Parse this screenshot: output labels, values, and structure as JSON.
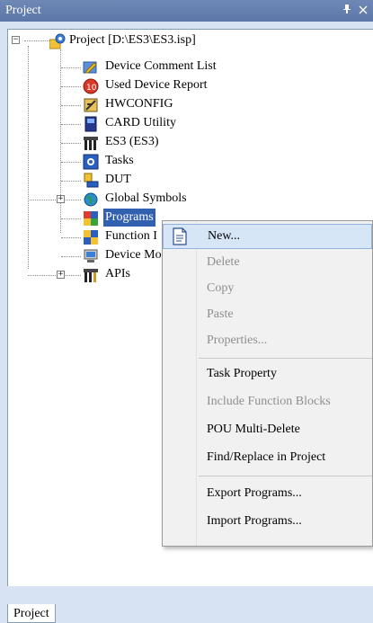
{
  "window": {
    "title": "Project",
    "pin_icon": "pin-icon",
    "close_icon": "close-icon"
  },
  "tree": {
    "root": {
      "label": "Project [D:\\ES3\\ES3.isp]",
      "icon": "project-gear-icon",
      "expander": "−"
    },
    "items": [
      {
        "label": "Device Comment List",
        "icon": "comment-list-icon"
      },
      {
        "label": "Used Device Report",
        "icon": "device-report-icon"
      },
      {
        "label": "HWCONFIG",
        "icon": "hwconfig-icon"
      },
      {
        "label": "CARD Utility",
        "icon": "card-utility-icon"
      },
      {
        "label": "ES3  (ES3)",
        "icon": "plc-device-icon"
      },
      {
        "label": "Tasks",
        "icon": "tasks-icon"
      },
      {
        "label": "DUT",
        "icon": "dut-icon"
      },
      {
        "label": "Global Symbols",
        "icon": "global-symbols-icon",
        "expander": "+"
      },
      {
        "label": "Programs",
        "icon": "programs-icon",
        "selected": true
      },
      {
        "label": "Function I",
        "icon": "function-blocks-icon"
      },
      {
        "label": "Device Mo",
        "icon": "device-monitor-icon"
      },
      {
        "label": "APIs",
        "icon": "apis-icon",
        "expander": "+"
      }
    ]
  },
  "context_menu": {
    "items": [
      {
        "label": "New...",
        "enabled": true,
        "hover": true,
        "icon": "new-document-icon"
      },
      {
        "label": "Delete",
        "enabled": false
      },
      {
        "label": "Copy",
        "enabled": false
      },
      {
        "label": "Paste",
        "enabled": false
      },
      {
        "label": "Properties...",
        "enabled": false
      },
      {
        "label": "Task Property",
        "enabled": true
      },
      {
        "label": "Include Function Blocks",
        "enabled": false
      },
      {
        "label": "POU Multi-Delete",
        "enabled": true
      },
      {
        "label": "Find/Replace in Project",
        "enabled": true
      },
      {
        "label": "Export Programs...",
        "enabled": true
      },
      {
        "label": "Import Programs...",
        "enabled": true
      }
    ]
  },
  "bottom_tabs": [
    {
      "label": "Project"
    }
  ],
  "colors": {
    "titlebar": "#5c77a8",
    "selection": "#3160b0",
    "menu_hover": "#d7e6f7",
    "disabled_text": "#8e8e8e"
  }
}
